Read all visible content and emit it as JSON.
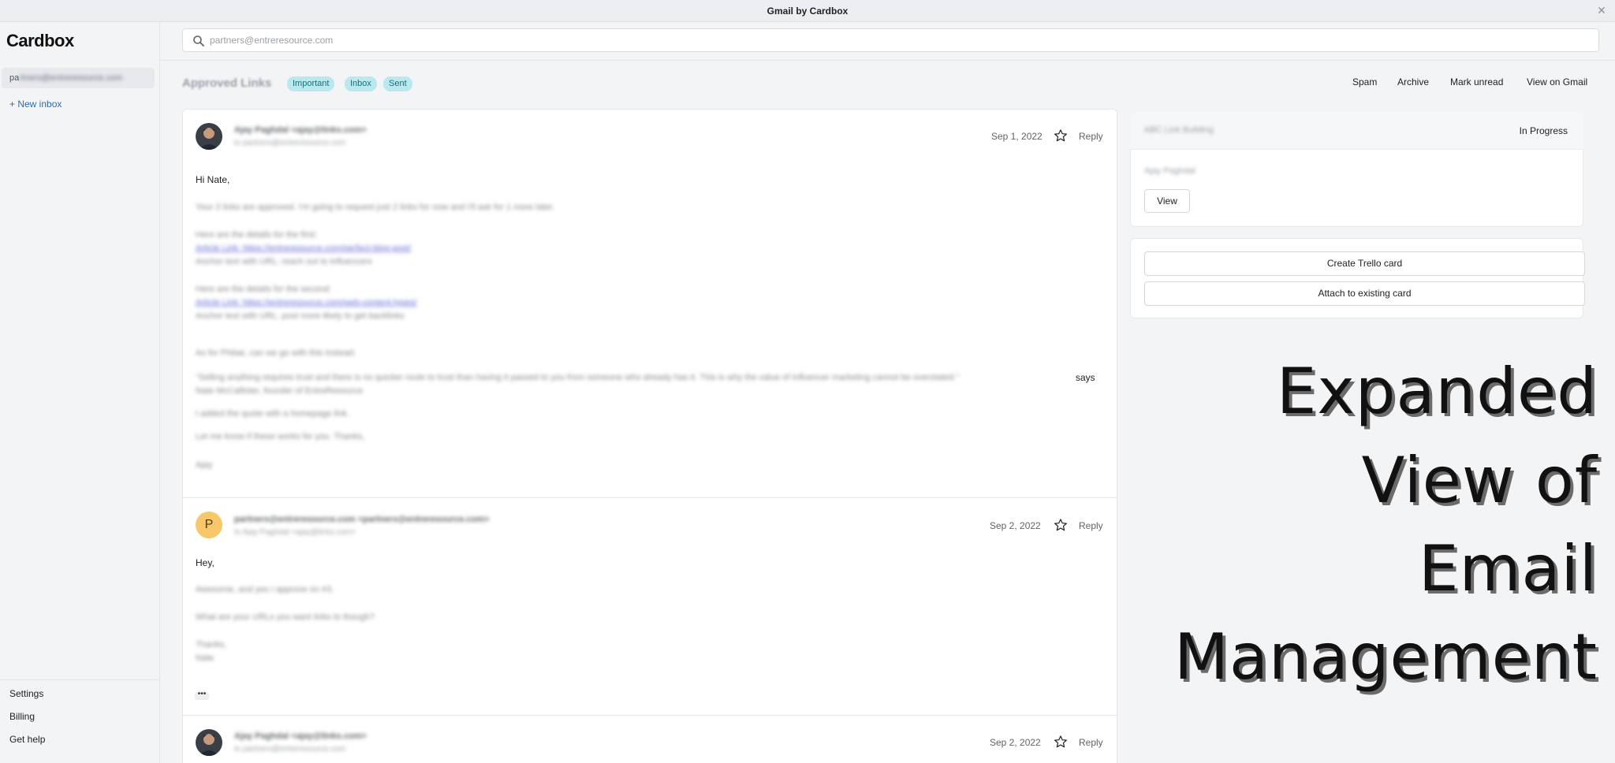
{
  "window": {
    "title": "Gmail by Cardbox"
  },
  "app": {
    "logo": "Cardbox"
  },
  "sidebar": {
    "inbox_prefix": "pa",
    "inbox_rest": "rtners@entreresource.com",
    "new_inbox": "+ New inbox",
    "settings": "Settings",
    "billing": "Billing",
    "help": "Get help"
  },
  "search": {
    "placeholder": "partners@entreresource.com"
  },
  "thread": {
    "title": "Approved Links",
    "tags": [
      "Important",
      "Inbox",
      "Sent"
    ],
    "actions": [
      "Spam",
      "Archive",
      "Mark unread",
      "View on Gmail"
    ]
  },
  "messages": [
    {
      "sender": "Ajay Paghdal <ajay@links.com>",
      "to": "to partners@entreresource.com",
      "date": "Sep 1, 2022",
      "reply": "Reply",
      "greeting": "Hi Nate,",
      "blurred": [
        "Your 3 links are approved. I'm going to request just 2 links for now and I'll ask for 1 more later.",
        "Here are the details for the first:",
        "Article Link: https://entreresource.com/perfect-blog-post/",
        "Anchor text with URL: reach out to influencers",
        "Here are the details for the second:",
        "Article Link: https://entreresource.com/web-content-types/",
        "Anchor text with URL: post more likely to get backlinks",
        "As for Philae, can we go with this instead:",
        "\"Selling anything requires trust and there is no quicker route to trust than having it passed to you from someone who already has it. This is why the value of influencer marketing cannot be overstated.\"",
        "Nate McCallister, founder of EntreResource",
        "I added the quote with a homepage link.",
        "Let me know if these works for you. Thanks,",
        "Ajay"
      ],
      "says": "says"
    },
    {
      "avatar_letter": "P",
      "sender": "partners@entreresource.com <partners@entreresource.com>",
      "to": "to Ajay Paghdal <ajay@links.com>",
      "date": "Sep 2, 2022",
      "reply": "Reply",
      "greeting": "Hey,",
      "blurred": [
        "Awesome, and yes I approve on #3.",
        "What are your URLs you want links to though?",
        "Thanks,",
        "Nate"
      ],
      "more": "•••"
    },
    {
      "sender": "Ajay Paghdal <ajay@links.com>",
      "to": "to partners@entreresource.com",
      "date": "Sep 2, 2022",
      "reply": "Reply"
    }
  ],
  "trello": {
    "card_title": "ABC Link Building",
    "status": "In Progress",
    "assignee": "Ajay Paghdal",
    "view_button": "View",
    "create_button": "Create Trello card",
    "attach_button": "Attach to existing card"
  },
  "overlay": {
    "lines": [
      "Expanded",
      "View of",
      "Email",
      "Management"
    ]
  }
}
